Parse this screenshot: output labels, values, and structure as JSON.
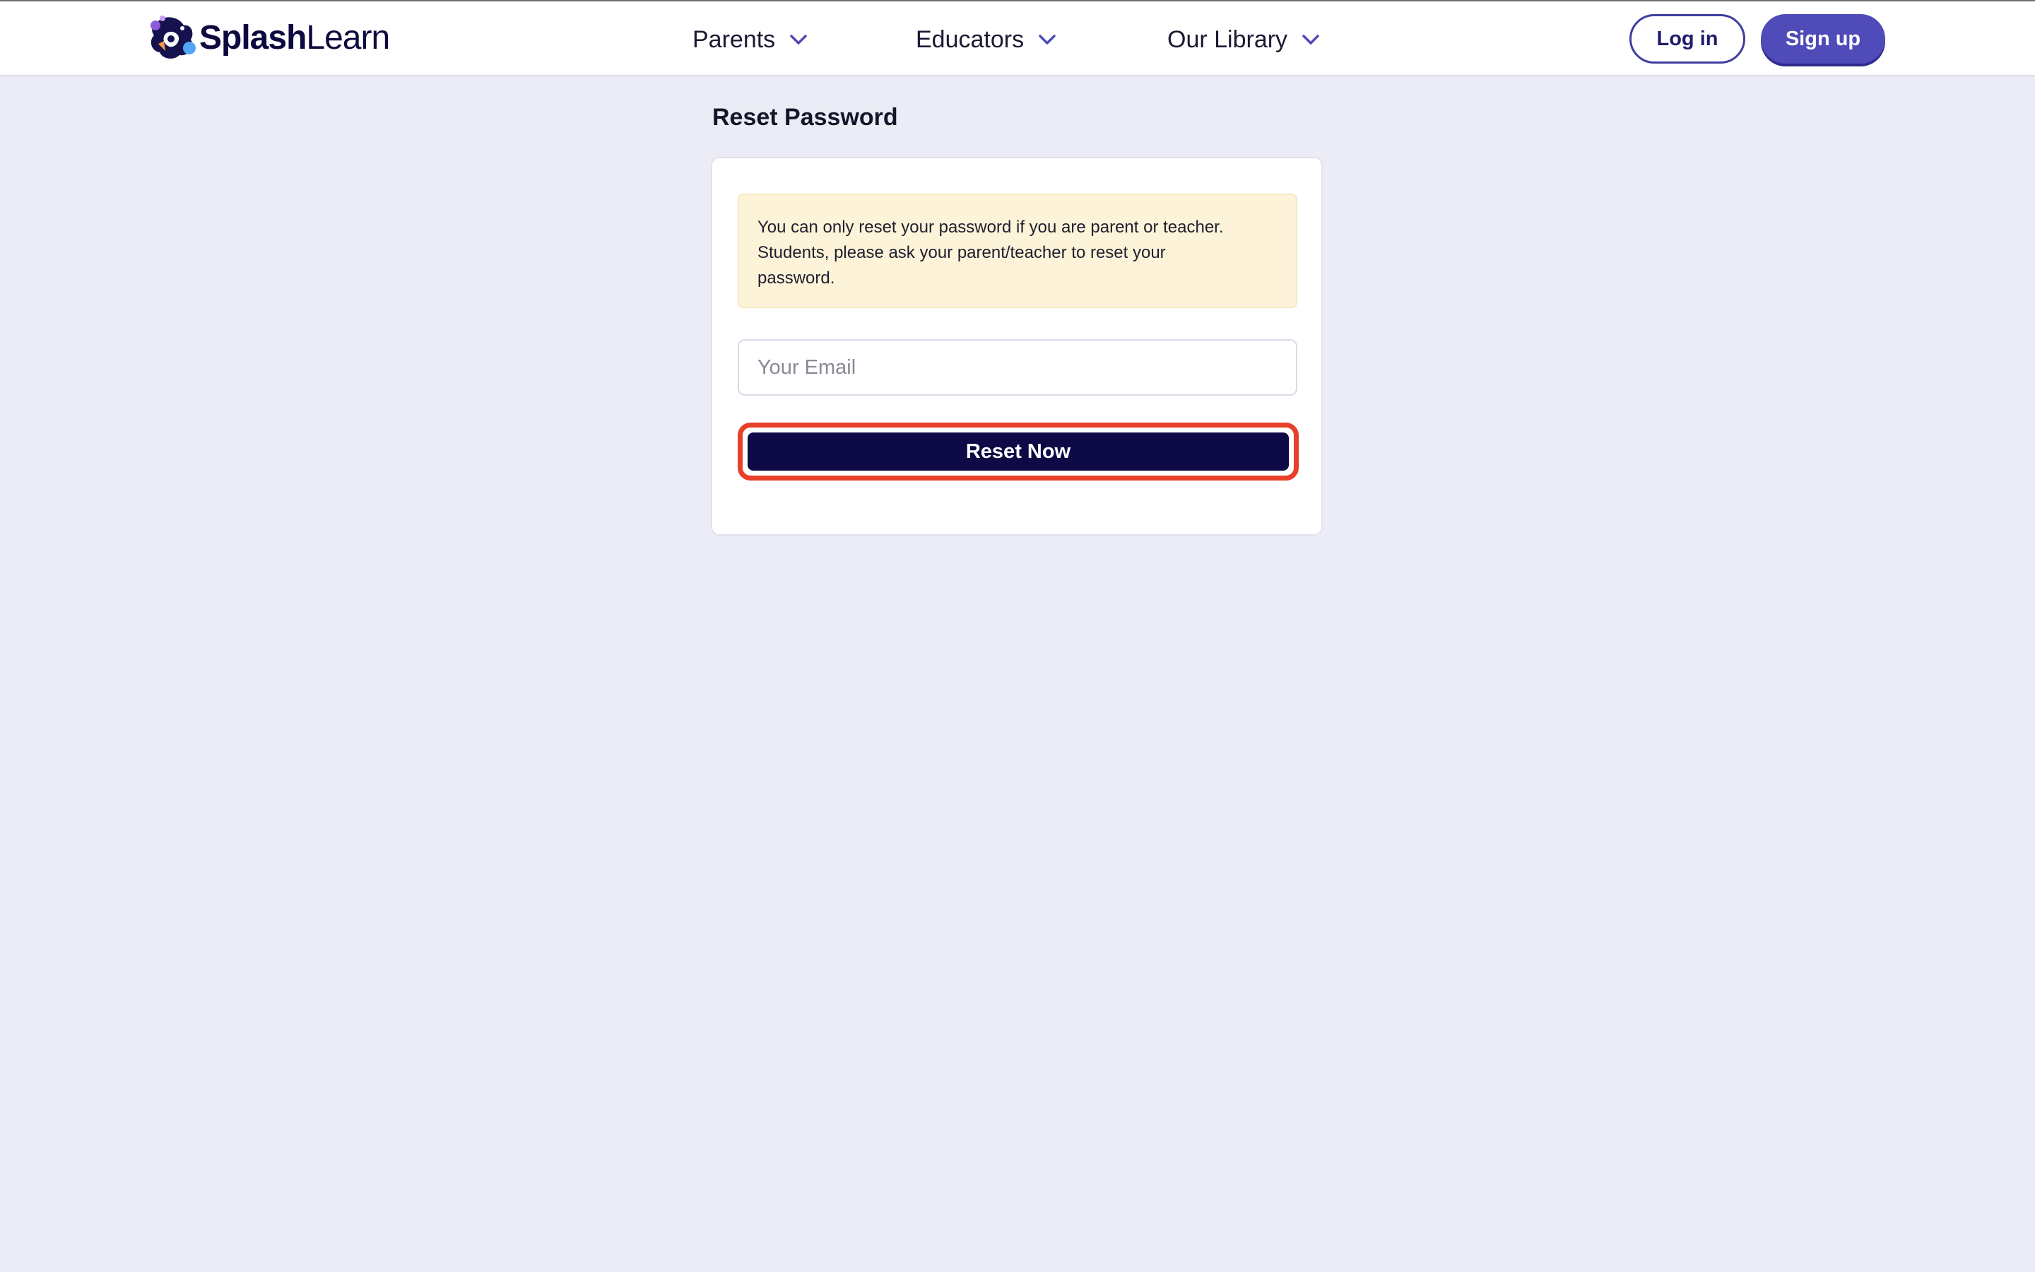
{
  "header": {
    "logo": {
      "bold": "Splash",
      "light": "Learn"
    },
    "nav": [
      {
        "label": "Parents",
        "icon": "chevron-down-icon"
      },
      {
        "label": "Educators",
        "icon": "chevron-down-icon"
      },
      {
        "label": "Our Library",
        "icon": "chevron-down-icon"
      }
    ],
    "login_label": "Log in",
    "signup_label": "Sign up"
  },
  "main": {
    "title": "Reset Password",
    "notice": {
      "line1": "You can only reset your password if you are parent or teacher.",
      "line2": "Students, please ask your parent/teacher to reset your",
      "line3": "password."
    },
    "email": {
      "placeholder": "Your Email",
      "value": ""
    },
    "reset_label": "Reset Now"
  },
  "colors": {
    "page_bg": "#ECECF6",
    "brand_navy": "#0E0A3F",
    "primary_button": "#0D0A45",
    "signup_button": "#4F4BB8",
    "notice_bg": "#FDF3D9",
    "highlight_ring": "#E8402A"
  }
}
